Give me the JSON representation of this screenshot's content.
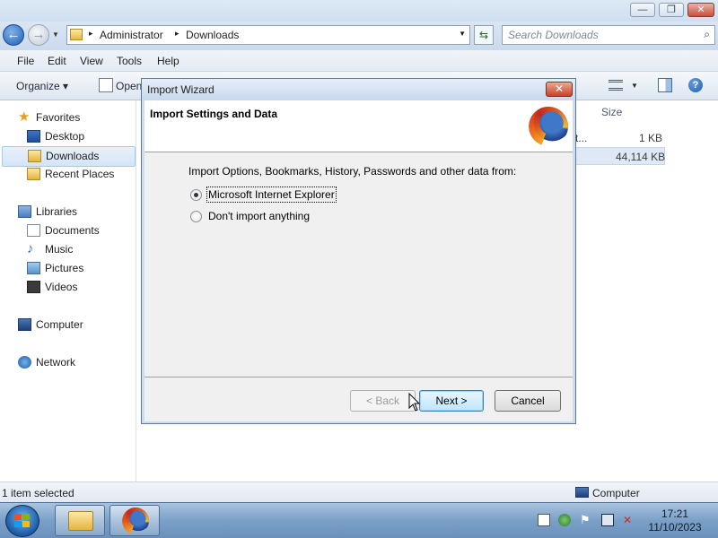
{
  "explorer": {
    "window_buttons": {
      "minimize": "—",
      "maximize": "❐",
      "close": "✕"
    },
    "address": {
      "crumbs": [
        "Administrator",
        "Downloads"
      ],
      "separator": "▸"
    },
    "search_placeholder": "Search Downloads",
    "menu": [
      "File",
      "Edit",
      "View",
      "Tools",
      "Help"
    ],
    "command_bar": {
      "organize": "Organize ▾",
      "open": "Open"
    },
    "nav": {
      "favorites": {
        "header": "Favorites",
        "items": [
          "Desktop",
          "Downloads",
          "Recent Places"
        ],
        "selected": "Downloads"
      },
      "libraries": {
        "header": "Libraries",
        "items": [
          "Documents",
          "Music",
          "Pictures",
          "Videos"
        ]
      },
      "computer": "Computer",
      "network": "Network"
    },
    "columns": {
      "size": "Size"
    },
    "rows": [
      {
        "name_tail": "t...",
        "size": "1 KB"
      },
      {
        "name_tail": "",
        "size": "44,114 KB"
      }
    ],
    "status": {
      "left": "1 item selected",
      "right": "Computer"
    }
  },
  "dialog": {
    "title": "Import Wizard",
    "close": "✕",
    "heading": "Import Settings and Data",
    "prompt": "Import Options, Bookmarks, History, Passwords and other data from:",
    "options": [
      {
        "label": "Microsoft Internet Explorer",
        "selected": true
      },
      {
        "label": "Don't import anything",
        "selected": false
      }
    ],
    "buttons": {
      "back": "< Back",
      "next": "Next >",
      "cancel": "Cancel"
    }
  },
  "taskbar": {
    "clock": {
      "time": "17:21",
      "date": "11/10/2023"
    }
  }
}
